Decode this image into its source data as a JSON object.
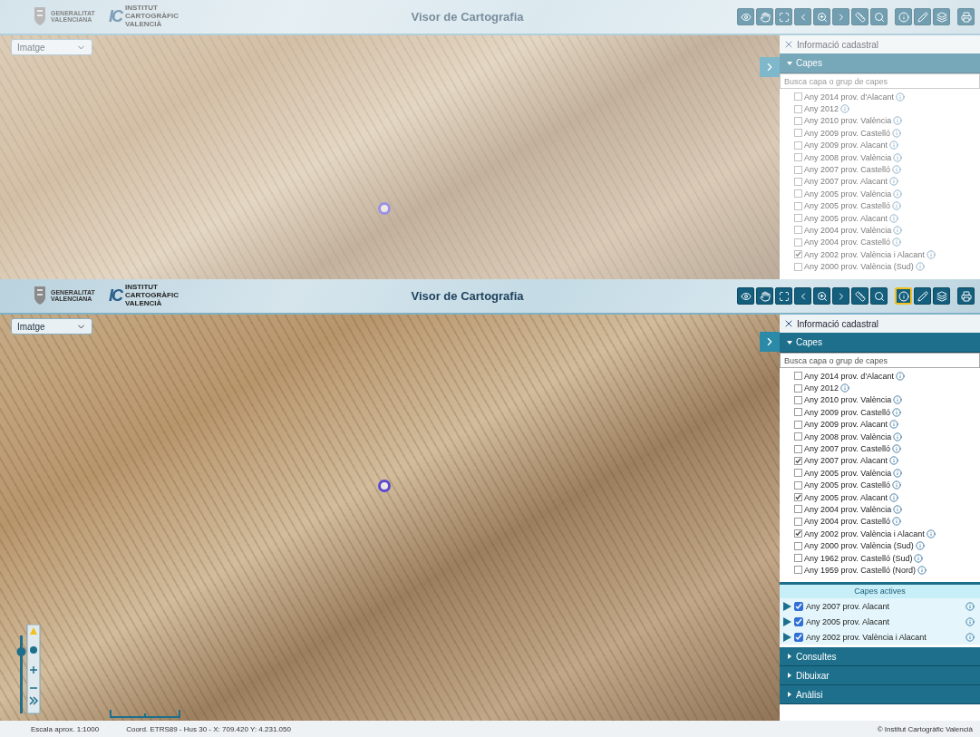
{
  "screens": [
    {
      "faded": true,
      "title": "Visor de Cartografia",
      "org_logo": "GENERALITAT VALENCIANA",
      "icv_mark": "IC",
      "icv_name": "INSTITUT CARTOGRÀFIC VALENCIÀ",
      "base_layer": "Imatge",
      "tools": [
        {
          "selected": false
        },
        {
          "selected": false
        },
        {
          "selected": false
        },
        {
          "selected": false
        },
        {
          "selected": false
        },
        {
          "selected": false
        },
        {
          "selected": false
        },
        {
          "selected": false
        },
        {
          "selected": false
        },
        {
          "selected": false
        },
        {
          "selected": false
        },
        {
          "selected": false
        }
      ],
      "info_tool": "Informació cadastral",
      "layers_title": "Capes",
      "search": {
        "placeholder": "Busca capa o grup de capes"
      },
      "layers": [
        {
          "label": "Any 2014 prov. d'Alacant",
          "checked": false
        },
        {
          "label": "Any 2012",
          "checked": false
        },
        {
          "label": "Any 2010 prov. València",
          "checked": false
        },
        {
          "label": "Any 2009 prov. Castelló",
          "checked": false
        },
        {
          "label": "Any 2009 prov. Alacant",
          "checked": false
        },
        {
          "label": "Any 2008 prov. València",
          "checked": false
        },
        {
          "label": "Any 2007 prov. Castelló",
          "checked": false
        },
        {
          "label": "Any 2007 prov. Alacant",
          "checked": false
        },
        {
          "label": "Any 2005 prov. València",
          "checked": false
        },
        {
          "label": "Any 2005 prov. Castelló",
          "checked": false
        },
        {
          "label": "Any 2005 prov. Alacant",
          "checked": false
        },
        {
          "label": "Any 2004 prov. València",
          "checked": false
        },
        {
          "label": "Any 2004 prov. Castelló",
          "checked": false
        },
        {
          "label": "Any 2002 prov. València i Alacant",
          "checked": true
        },
        {
          "label": "Any 2000 prov. València (Sud)",
          "checked": false
        }
      ]
    },
    {
      "faded": false,
      "title": "Visor de Cartografia",
      "org_logo": "GENERALITAT VALENCIANA",
      "icv_mark": "IC",
      "icv_name": "INSTITUT CARTOGRÀFIC VALENCIÀ",
      "base_layer": "Imatge",
      "tools": [
        {
          "selected": false
        },
        {
          "selected": false
        },
        {
          "selected": false
        },
        {
          "selected": false
        },
        {
          "selected": false
        },
        {
          "selected": false
        },
        {
          "selected": false
        },
        {
          "selected": false
        },
        {
          "selected": true
        },
        {
          "selected": false
        },
        {
          "selected": false
        },
        {
          "selected": false
        }
      ],
      "info_tool": "Informació cadastral",
      "layers_title": "Capes",
      "search": {
        "placeholder": "Busca capa o grup de capes"
      },
      "layers": [
        {
          "label": "Any 2014 prov. d'Alacant",
          "checked": false
        },
        {
          "label": "Any 2012",
          "checked": false
        },
        {
          "label": "Any 2010 prov. València",
          "checked": false
        },
        {
          "label": "Any 2009 prov. Castelló",
          "checked": false
        },
        {
          "label": "Any 2009 prov. Alacant",
          "checked": false
        },
        {
          "label": "Any 2008 prov. València",
          "checked": false
        },
        {
          "label": "Any 2007 prov. Castelló",
          "checked": false
        },
        {
          "label": "Any 2007 prov. Alacant",
          "checked": true
        },
        {
          "label": "Any 2005 prov. València",
          "checked": false
        },
        {
          "label": "Any 2005 prov. Castelló",
          "checked": false
        },
        {
          "label": "Any 2005 prov. Alacant",
          "checked": true
        },
        {
          "label": "Any 2004 prov. València",
          "checked": false
        },
        {
          "label": "Any 2004 prov. Castelló",
          "checked": false
        },
        {
          "label": "Any 2002 prov. València i Alacant",
          "checked": true
        },
        {
          "label": "Any 2000 prov. València (Sud)",
          "checked": false
        },
        {
          "label": "Any 1962 prov. Castelló (Sud)",
          "checked": false
        },
        {
          "label": "Any 1959 prov. Castelló (Nord)",
          "checked": false
        }
      ],
      "active_title": "Capes actives",
      "active_layers": [
        {
          "label": "Any 2007 prov. Alacant",
          "checked": true
        },
        {
          "label": "Any 2005 prov. Alacant",
          "checked": true
        },
        {
          "label": "Any 2002 prov. València i Alacant",
          "checked": true
        }
      ],
      "sections": [
        "Consultes",
        "Dibuixar",
        "Anàlisi"
      ],
      "status_bar": {
        "scale": "Escala aprox. 1:1000",
        "coords": "Coord. ETRS89 - Hus 30 - X: 709.420 Y: 4.231.050",
        "credit": "© Institut Cartogràfic Valencià"
      }
    }
  ]
}
